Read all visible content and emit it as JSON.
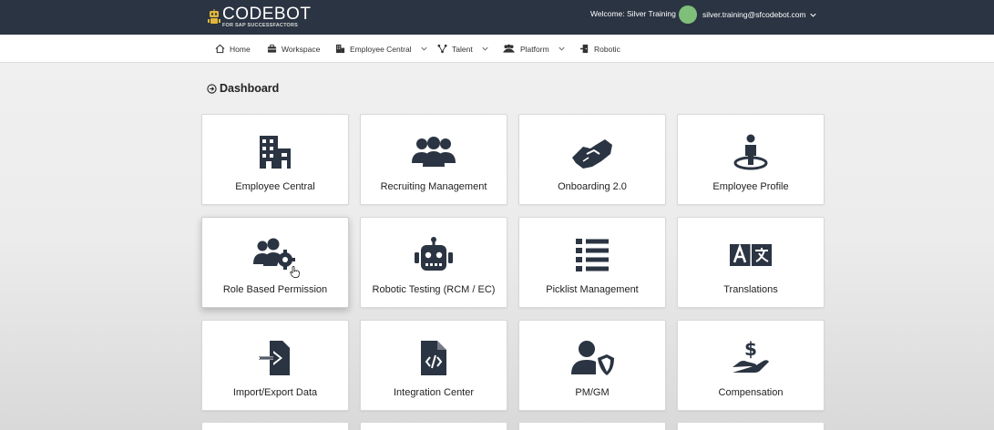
{
  "header": {
    "logo_main": "CODEBOT",
    "logo_sub": "FOR SAP SUCCESSFACTORS",
    "welcome": "Welcome: Silver Training",
    "user_email": "silver.training@sfcodebot.com",
    "avatar_color": "#7fbf7a",
    "bg_color": "#2b3442"
  },
  "nav": {
    "items": [
      {
        "label": "Home",
        "icon": "home-icon"
      },
      {
        "label": "Workspace",
        "icon": "briefcase-icon"
      },
      {
        "label": "Employee Central",
        "icon": "building-icon",
        "dropdown": true
      },
      {
        "label": "Talent",
        "icon": "network-icon",
        "dropdown": true
      },
      {
        "label": "Platform",
        "icon": "users-icon",
        "dropdown": true
      },
      {
        "label": "Robotic",
        "icon": "door-icon"
      }
    ]
  },
  "dashboard": {
    "title": "Dashboard",
    "cards": [
      {
        "label": "Employee Central",
        "icon": "building-icon"
      },
      {
        "label": "Recruiting Management",
        "icon": "people-group-icon"
      },
      {
        "label": "Onboarding 2.0",
        "icon": "handshake-icon"
      },
      {
        "label": "Employee Profile",
        "icon": "person-location-icon"
      },
      {
        "label": "Role Based Permission",
        "icon": "users-gear-icon"
      },
      {
        "label": "Robotic Testing (RCM / EC)",
        "icon": "robot-icon"
      },
      {
        "label": "Picklist Management",
        "icon": "list-icon"
      },
      {
        "label": "Translations",
        "icon": "language-icon"
      },
      {
        "label": "Import/Export Data",
        "icon": "file-import-icon"
      },
      {
        "label": "Integration Center",
        "icon": "file-code-icon"
      },
      {
        "label": "PM/GM",
        "icon": "user-shield-icon"
      },
      {
        "label": "Compensation",
        "icon": "hand-dollar-icon"
      }
    ]
  },
  "colors": {
    "icon": "#2b3442",
    "card_bg": "#ffffff"
  }
}
